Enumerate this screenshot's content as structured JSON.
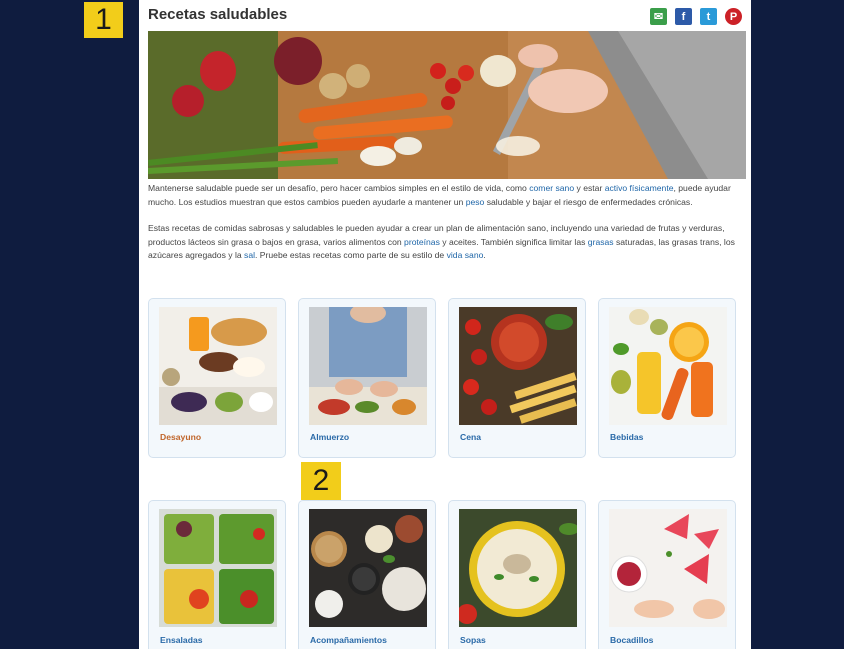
{
  "badges": {
    "one": "1",
    "two": "2"
  },
  "header": {
    "title": "Recetas saludables",
    "share": [
      {
        "name": "email-icon",
        "glyph": "✉"
      },
      {
        "name": "facebook-icon",
        "glyph": "f"
      },
      {
        "name": "twitter-icon",
        "glyph": "t"
      },
      {
        "name": "pinterest-icon",
        "glyph": "P"
      }
    ]
  },
  "intro": {
    "p1": {
      "t1": "Mantenerse saludable puede ser un desafío, pero hacer cambios simples en el estilo de vida, como ",
      "l1": "comer sano",
      "t2": " y estar ",
      "l2": "activo físicamente",
      "t3": ", puede ayudar mucho. Los estudios muestran que estos cambios pueden ayudarle a mantener un ",
      "l3": "peso",
      "t4": " saludable y bajar el riesgo de enfermedades crónicas."
    },
    "p2": {
      "t1": "Estas recetas de comidas sabrosas y saludables le pueden ayudar a crear un plan de alimentación sano, incluyendo una variedad de frutas y verduras, productos lácteos sin grasa o bajos en grasa, varios alimentos con ",
      "l1": "proteínas",
      "t2": " y aceites. También significa limitar las ",
      "l2": "grasas",
      "t3": " saturadas, las grasas trans, los azúcares agregados y la ",
      "l3": "sal",
      "t4": ". Pruebe estas recetas como parte de su estilo de ",
      "l4": "vida sano",
      "t5": "."
    }
  },
  "cards": [
    {
      "label": "Desayuno"
    },
    {
      "label": "Almuerzo"
    },
    {
      "label": "Cena"
    },
    {
      "label": "Bebidas"
    },
    {
      "label": "Ensaladas"
    },
    {
      "label": "Acompañamientos"
    },
    {
      "label": "Sopas"
    },
    {
      "label": "Bocadillos"
    }
  ],
  "colors": {
    "link": "#1f66a8",
    "card_label": "#2a6aa8",
    "accent_label": "#c0652a",
    "badge": "#f2cd1a",
    "background": "#0f1c3f"
  }
}
